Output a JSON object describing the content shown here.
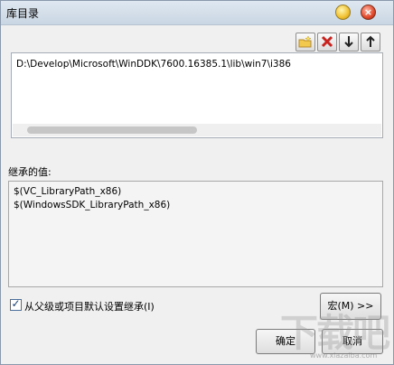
{
  "window": {
    "title": "库目录"
  },
  "toolbar": {
    "new_icon": "new-folder-icon",
    "delete_icon": "delete-icon",
    "down_icon": "arrow-down-icon",
    "up_icon": "arrow-up-icon"
  },
  "directories": {
    "entries": [
      "D:\\Develop\\Microsoft\\WinDDK\\7600.16385.1\\lib\\win7\\i386"
    ]
  },
  "inherited": {
    "label": "继承的值:",
    "values": [
      "$(VC_LibraryPath_x86)",
      "$(WindowsSDK_LibraryPath_x86)"
    ]
  },
  "inherit_checkbox": {
    "label": "从父级或项目默认设置继承(I)",
    "checked": true
  },
  "buttons": {
    "macros": "宏(M) >>",
    "ok": "确定",
    "cancel": "取消"
  },
  "watermark": {
    "big": "下载吧",
    "small": "www.xiazaiba.com"
  }
}
